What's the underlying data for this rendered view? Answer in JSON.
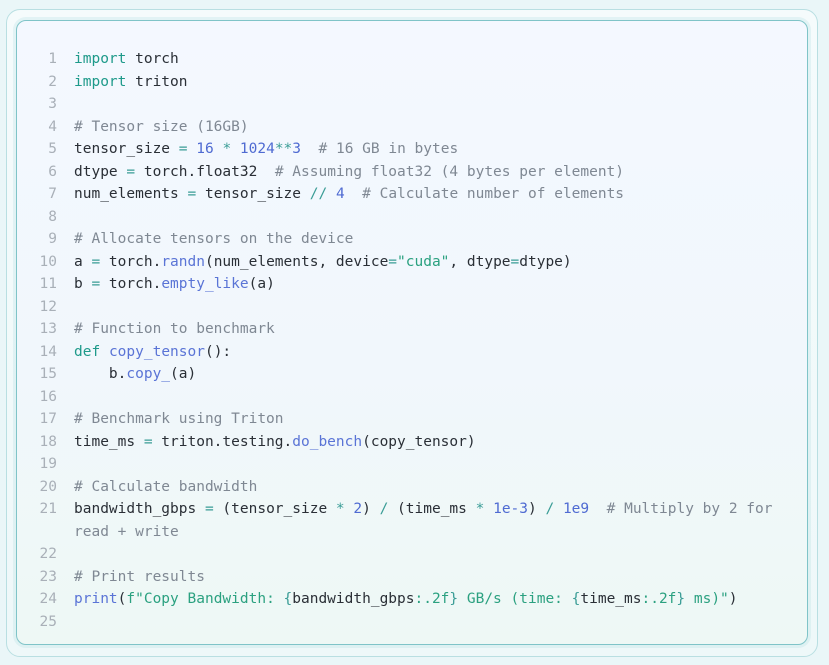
{
  "code": {
    "lines": [
      {
        "n": "1",
        "tokens": [
          {
            "t": "import",
            "k": "kw"
          },
          {
            "t": " torch",
            "k": "txt"
          }
        ]
      },
      {
        "n": "2",
        "tokens": [
          {
            "t": "import",
            "k": "kw"
          },
          {
            "t": " triton",
            "k": "txt"
          }
        ]
      },
      {
        "n": "3",
        "tokens": []
      },
      {
        "n": "4",
        "tokens": [
          {
            "t": "# Tensor size (16GB)",
            "k": "cm"
          }
        ]
      },
      {
        "n": "5",
        "tokens": [
          {
            "t": "tensor_size ",
            "k": "txt"
          },
          {
            "t": "=",
            "k": "op"
          },
          {
            "t": " ",
            "k": "txt"
          },
          {
            "t": "16",
            "k": "num"
          },
          {
            "t": " ",
            "k": "txt"
          },
          {
            "t": "*",
            "k": "op"
          },
          {
            "t": " ",
            "k": "txt"
          },
          {
            "t": "1024",
            "k": "num"
          },
          {
            "t": "**",
            "k": "op"
          },
          {
            "t": "3",
            "k": "num"
          },
          {
            "t": "  ",
            "k": "txt"
          },
          {
            "t": "# 16 GB in bytes",
            "k": "cm"
          }
        ]
      },
      {
        "n": "6",
        "tokens": [
          {
            "t": "dtype ",
            "k": "txt"
          },
          {
            "t": "=",
            "k": "op"
          },
          {
            "t": " torch.float32  ",
            "k": "txt"
          },
          {
            "t": "# Assuming float32 (4 bytes per element)",
            "k": "cm"
          }
        ]
      },
      {
        "n": "7",
        "tokens": [
          {
            "t": "num_elements ",
            "k": "txt"
          },
          {
            "t": "=",
            "k": "op"
          },
          {
            "t": " tensor_size ",
            "k": "txt"
          },
          {
            "t": "//",
            "k": "op"
          },
          {
            "t": " ",
            "k": "txt"
          },
          {
            "t": "4",
            "k": "num"
          },
          {
            "t": "  ",
            "k": "txt"
          },
          {
            "t": "# Calculate number of elements",
            "k": "cm"
          }
        ]
      },
      {
        "n": "8",
        "tokens": []
      },
      {
        "n": "9",
        "tokens": [
          {
            "t": "# Allocate tensors on the device",
            "k": "cm"
          }
        ]
      },
      {
        "n": "10",
        "tokens": [
          {
            "t": "a ",
            "k": "txt"
          },
          {
            "t": "=",
            "k": "op"
          },
          {
            "t": " torch.",
            "k": "txt"
          },
          {
            "t": "randn",
            "k": "fn"
          },
          {
            "t": "(num_elements, device",
            "k": "txt"
          },
          {
            "t": "=",
            "k": "op"
          },
          {
            "t": "\"cuda\"",
            "k": "str"
          },
          {
            "t": ", dtype",
            "k": "txt"
          },
          {
            "t": "=",
            "k": "op"
          },
          {
            "t": "dtype)",
            "k": "txt"
          }
        ]
      },
      {
        "n": "11",
        "tokens": [
          {
            "t": "b ",
            "k": "txt"
          },
          {
            "t": "=",
            "k": "op"
          },
          {
            "t": " torch.",
            "k": "txt"
          },
          {
            "t": "empty_like",
            "k": "fn"
          },
          {
            "t": "(a)",
            "k": "txt"
          }
        ]
      },
      {
        "n": "12",
        "tokens": []
      },
      {
        "n": "13",
        "tokens": [
          {
            "t": "# Function to benchmark",
            "k": "cm"
          }
        ]
      },
      {
        "n": "14",
        "tokens": [
          {
            "t": "def",
            "k": "kw"
          },
          {
            "t": " ",
            "k": "txt"
          },
          {
            "t": "copy_tensor",
            "k": "fn"
          },
          {
            "t": "():",
            "k": "txt"
          }
        ]
      },
      {
        "n": "15",
        "tokens": [
          {
            "t": "    b.",
            "k": "txt"
          },
          {
            "t": "copy_",
            "k": "fn"
          },
          {
            "t": "(a)",
            "k": "txt"
          }
        ]
      },
      {
        "n": "16",
        "tokens": []
      },
      {
        "n": "17",
        "tokens": [
          {
            "t": "# Benchmark using Triton",
            "k": "cm"
          }
        ]
      },
      {
        "n": "18",
        "tokens": [
          {
            "t": "time_ms ",
            "k": "txt"
          },
          {
            "t": "=",
            "k": "op"
          },
          {
            "t": " triton.testing.",
            "k": "txt"
          },
          {
            "t": "do_bench",
            "k": "fn"
          },
          {
            "t": "(copy_tensor)",
            "k": "txt"
          }
        ]
      },
      {
        "n": "19",
        "tokens": []
      },
      {
        "n": "20",
        "tokens": [
          {
            "t": "# Calculate bandwidth",
            "k": "cm"
          }
        ]
      },
      {
        "n": "21",
        "tokens": [
          {
            "t": "bandwidth_gbps ",
            "k": "txt"
          },
          {
            "t": "=",
            "k": "op"
          },
          {
            "t": " (tensor_size ",
            "k": "txt"
          },
          {
            "t": "*",
            "k": "op"
          },
          {
            "t": " ",
            "k": "txt"
          },
          {
            "t": "2",
            "k": "num"
          },
          {
            "t": ") ",
            "k": "txt"
          },
          {
            "t": "/",
            "k": "op"
          },
          {
            "t": " (time_ms ",
            "k": "txt"
          },
          {
            "t": "*",
            "k": "op"
          },
          {
            "t": " ",
            "k": "txt"
          },
          {
            "t": "1e-3",
            "k": "num"
          },
          {
            "t": ") ",
            "k": "txt"
          },
          {
            "t": "/",
            "k": "op"
          },
          {
            "t": " ",
            "k": "txt"
          },
          {
            "t": "1e9",
            "k": "num"
          },
          {
            "t": "  ",
            "k": "txt"
          },
          {
            "t": "# Multiply by 2 for read + write",
            "k": "cm"
          }
        ]
      },
      {
        "n": "22",
        "tokens": []
      },
      {
        "n": "23",
        "tokens": [
          {
            "t": "# Print results",
            "k": "cm"
          }
        ]
      },
      {
        "n": "24",
        "tokens": [
          {
            "t": "print",
            "k": "fn"
          },
          {
            "t": "(",
            "k": "txt"
          },
          {
            "t": "f\"Copy Bandwidth: ",
            "k": "str"
          },
          {
            "t": "{",
            "k": "op"
          },
          {
            "t": "bandwidth_gbps",
            "k": "txt"
          },
          {
            "t": ":.2f",
            "k": "str"
          },
          {
            "t": "}",
            "k": "op"
          },
          {
            "t": " GB/s (time: ",
            "k": "str"
          },
          {
            "t": "{",
            "k": "op"
          },
          {
            "t": "time_ms",
            "k": "txt"
          },
          {
            "t": ":.2f",
            "k": "str"
          },
          {
            "t": "}",
            "k": "op"
          },
          {
            "t": " ms)\"",
            "k": "str"
          },
          {
            "t": ")",
            "k": "txt"
          }
        ]
      },
      {
        "n": "25",
        "tokens": []
      }
    ]
  }
}
